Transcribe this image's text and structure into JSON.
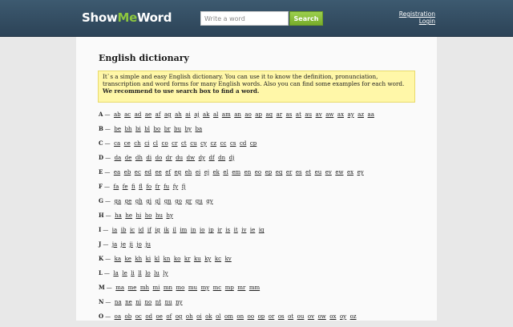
{
  "header": {
    "logo": {
      "part1": "Show",
      "part2": "Me",
      "part3": "Word"
    },
    "search": {
      "placeholder": "Write a word",
      "value": "",
      "button_label": "Search"
    },
    "links": {
      "registration": "Registration",
      "login": "Login"
    }
  },
  "main": {
    "title": "English dictionary",
    "notice": {
      "text": "It`s a simple and easy English dictionary. You can use it to know the definition, pronunciation, transcription and word forms for many English words. Also you can find some examples for each word.",
      "strong": "We recommend to use search box to find a word."
    },
    "dash": "—",
    "rows": [
      {
        "letter": "A",
        "links": [
          "ab",
          "ac",
          "ad",
          "ae",
          "af",
          "ag",
          "ah",
          "ai",
          "aj",
          "ak",
          "al",
          "am",
          "an",
          "ao",
          "ap",
          "aq",
          "ar",
          "as",
          "at",
          "au",
          "av",
          "aw",
          "ax",
          "ay",
          "az",
          "aa"
        ]
      },
      {
        "letter": "B",
        "links": [
          "be",
          "bh",
          "bi",
          "bl",
          "bo",
          "br",
          "bu",
          "by",
          "ba"
        ]
      },
      {
        "letter": "C",
        "links": [
          "ca",
          "ce",
          "ch",
          "ci",
          "cl",
          "co",
          "cr",
          "ct",
          "cu",
          "cy",
          "cz",
          "cc",
          "cs",
          "cd",
          "cp"
        ]
      },
      {
        "letter": "D",
        "links": [
          "da",
          "de",
          "dh",
          "di",
          "do",
          "dr",
          "du",
          "dw",
          "dy",
          "df",
          "dn",
          "dj"
        ]
      },
      {
        "letter": "E",
        "links": [
          "ea",
          "eb",
          "ec",
          "ed",
          "ee",
          "ef",
          "eg",
          "eh",
          "ei",
          "ej",
          "ek",
          "el",
          "em",
          "en",
          "eo",
          "ep",
          "eq",
          "er",
          "es",
          "et",
          "eu",
          "ev",
          "ew",
          "ex",
          "ey"
        ]
      },
      {
        "letter": "F",
        "links": [
          "fa",
          "fe",
          "fi",
          "fl",
          "fo",
          "fr",
          "fu",
          "fy",
          "fj"
        ]
      },
      {
        "letter": "G",
        "links": [
          "ga",
          "ge",
          "gh",
          "gi",
          "gl",
          "gn",
          "go",
          "gr",
          "gu",
          "gy"
        ]
      },
      {
        "letter": "H",
        "links": [
          "ha",
          "he",
          "hi",
          "ho",
          "hu",
          "hy"
        ]
      },
      {
        "letter": "I",
        "links": [
          "ia",
          "ib",
          "ic",
          "id",
          "if",
          "ig",
          "ik",
          "il",
          "im",
          "in",
          "io",
          "ip",
          "ir",
          "is",
          "it",
          "iv",
          "ie",
          "iq"
        ]
      },
      {
        "letter": "J",
        "links": [
          "ja",
          "je",
          "ji",
          "jo",
          "ju"
        ]
      },
      {
        "letter": "K",
        "links": [
          "ka",
          "ke",
          "kh",
          "ki",
          "kl",
          "kn",
          "ko",
          "kr",
          "ku",
          "ky",
          "kc",
          "kv"
        ]
      },
      {
        "letter": "L",
        "links": [
          "la",
          "le",
          "li",
          "ll",
          "lo",
          "lu",
          "ly"
        ]
      },
      {
        "letter": "M",
        "links": [
          "ma",
          "me",
          "mh",
          "mi",
          "mn",
          "mo",
          "mu",
          "my",
          "mc",
          "mp",
          "mr",
          "mm"
        ]
      },
      {
        "letter": "N",
        "links": [
          "na",
          "ne",
          "ni",
          "no",
          "nt",
          "nu",
          "ny"
        ]
      },
      {
        "letter": "O",
        "links": [
          "oa",
          "ob",
          "oc",
          "od",
          "oe",
          "of",
          "og",
          "oh",
          "oi",
          "ok",
          "ol",
          "om",
          "on",
          "oo",
          "op",
          "or",
          "os",
          "ot",
          "ou",
          "ov",
          "ow",
          "ox",
          "oy",
          "oz"
        ]
      }
    ]
  }
}
